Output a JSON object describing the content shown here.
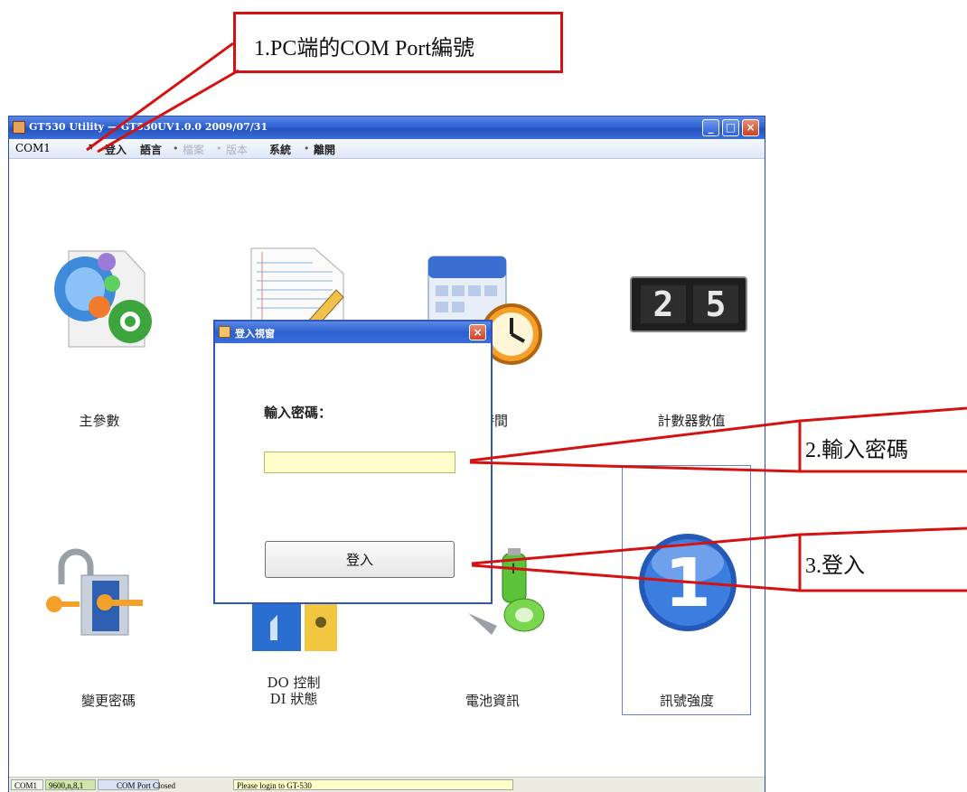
{
  "window": {
    "title": "GT530 Utility — GT530UV1.0.0 2009/07/31",
    "colors": {
      "titlebar": "#2f63d2",
      "menubar": "#dfe8f6",
      "accent_red": "#d41212"
    }
  },
  "menubar": {
    "com_port": "COM1",
    "items": [
      {
        "label": "登入",
        "enabled": true
      },
      {
        "label": "語言",
        "enabled": true
      },
      {
        "label": "檔案",
        "enabled": false
      },
      {
        "label": "版本",
        "enabled": false
      },
      {
        "label": "系統",
        "enabled": true
      },
      {
        "label": "離開",
        "enabled": true
      }
    ]
  },
  "tiles": {
    "main_params": "主參數",
    "time": "時間",
    "counter": "計數器數值",
    "counter_digits": [
      "2",
      "5"
    ],
    "change_password": "變更密碼",
    "do_control": "DO 控制",
    "di_status": "DI 狀態",
    "battery": "電池資訊",
    "signal": "訊號強度",
    "signal_value": "1"
  },
  "dialog": {
    "title": "登入視窗",
    "password_label": "輸入密碼：",
    "password_value": "",
    "login_button": "登入"
  },
  "statusbar": {
    "port": "COM1",
    "settings": "9600,n,8,1",
    "state": "COM Port Closed",
    "message": "Please login to GT-530"
  },
  "callouts": {
    "c1": "1.PC端的COM Port編號",
    "c2": "2.輸入密碼",
    "c3": "3.登入"
  }
}
